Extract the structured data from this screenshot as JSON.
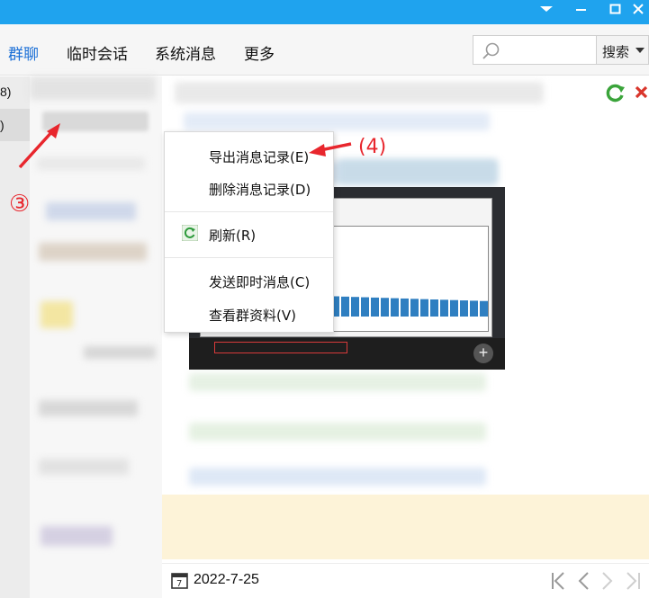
{
  "titlebar": {
    "bg": "#1fa3ee"
  },
  "nav": {
    "tabs": [
      {
        "label": "群聊",
        "active": true
      },
      {
        "label": "临时会话",
        "active": false
      },
      {
        "label": "系统消息",
        "active": false
      },
      {
        "label": "更多",
        "active": false
      }
    ],
    "search_placeholder": "",
    "search_button": "搜索"
  },
  "left": {
    "counts": [
      "8)",
      ")"
    ]
  },
  "context_menu": {
    "items": [
      {
        "label": "导出消息记录(E)",
        "icon": ""
      },
      {
        "label": "删除消息记录(D)",
        "icon": ""
      },
      {
        "label": "刷新(R)",
        "icon": "refresh-icon"
      },
      {
        "label": "发送即时消息(C)",
        "icon": ""
      },
      {
        "label": "查看群资料(V)",
        "icon": ""
      }
    ]
  },
  "annotations": {
    "step3": "③",
    "step4": "(4)",
    "color": "#e8262d"
  },
  "bottom": {
    "date": "2022-7-25"
  },
  "colors": {
    "accent": "#1b6fd6",
    "bar": "#2f7fc1"
  }
}
